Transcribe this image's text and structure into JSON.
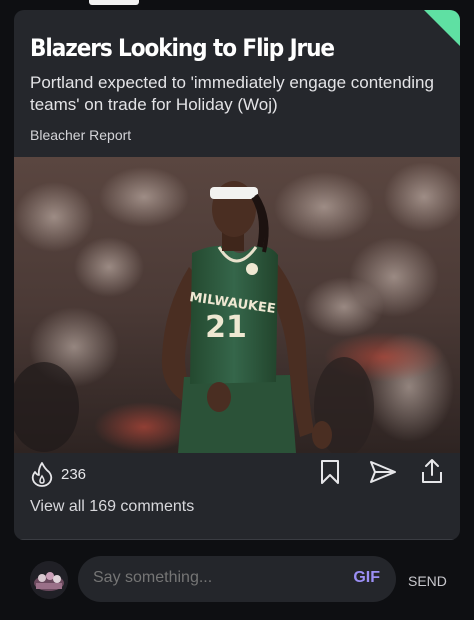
{
  "post": {
    "headline": "Blazers Looking to Flip Jrue",
    "subtitle": "Portland expected to 'immediately engage contending teams' on trade for Holiday (Woj)",
    "source": "Bleacher Report",
    "photo": {
      "jersey_team": "MILWAUKEE",
      "jersey_number": "21",
      "alt": "Basketball player in green Milwaukee jersey number 21"
    }
  },
  "actions": {
    "likes_count": "236",
    "view_comments": "View all 169 comments",
    "icons": [
      "fire-icon",
      "bookmark-icon",
      "send-icon",
      "share-icon"
    ]
  },
  "composer": {
    "placeholder": "Say something...",
    "gif_label": "GIF",
    "send_label": "SEND"
  },
  "colors": {
    "background": "#0e0f12",
    "card": "#25272c",
    "accent_corner": "#5fe0a3",
    "gif": "#9b8ff5",
    "jersey_green": "#2d5a3d"
  }
}
